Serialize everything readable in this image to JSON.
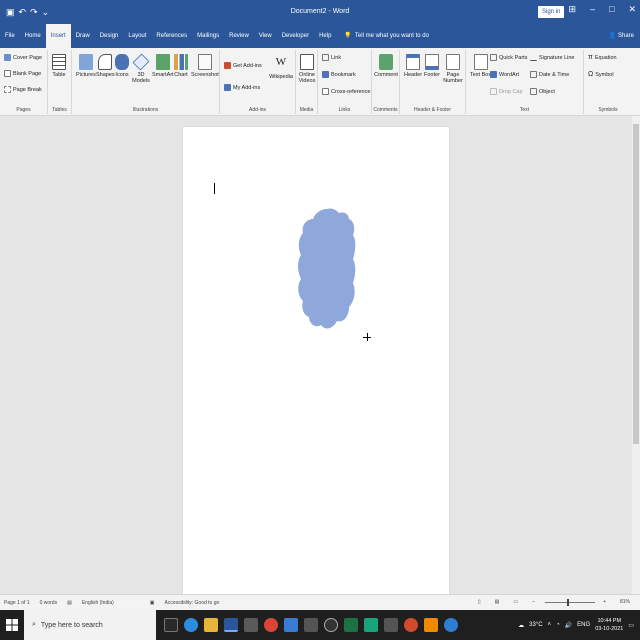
{
  "title_bar": {
    "document_title": "Document2 - Word",
    "signin_label": "Sign in",
    "qat_icons": [
      "save-icon",
      "undo-icon",
      "redo-icon"
    ]
  },
  "ribbon_tabs": [
    "File",
    "Home",
    "Insert",
    "Draw",
    "Design",
    "Layout",
    "References",
    "Mailings",
    "Review",
    "View",
    "Developer",
    "Help"
  ],
  "active_tab": "Insert",
  "tell_me": "Tell me what you want to do",
  "share_label": "Share",
  "groups": {
    "pages": {
      "label": "Pages",
      "items": [
        "Cover Page",
        "Blank Page",
        "Page Break"
      ]
    },
    "tables": {
      "label": "Tables",
      "table": "Table"
    },
    "illustrations": {
      "label": "Illustrations",
      "pictures": "Pictures",
      "shapes": "Shapes",
      "icons": "Icons",
      "models": "3D Models",
      "smartart": "SmartArt",
      "chart": "Chart",
      "screenshot": "Screenshot"
    },
    "addins": {
      "label": "Add-ins",
      "get": "Get Add-ins",
      "my": "My Add-ins",
      "wikipedia": "Wikipedia"
    },
    "media": {
      "label": "Media",
      "online_videos": "Online Videos"
    },
    "links": {
      "label": "Links",
      "link": "Link",
      "bookmark": "Bookmark",
      "crossref": "Cross-reference"
    },
    "comments": {
      "label": "Comments",
      "comment": "Comment"
    },
    "header_footer": {
      "label": "Header & Footer",
      "header": "Header",
      "footer": "Footer",
      "page_number": "Page Number"
    },
    "text": {
      "label": "Text",
      "text_box": "Text Box",
      "quick_parts": "Quick Parts",
      "wordart": "WordArt",
      "drop_cap": "Drop Cap",
      "signature_line": "Signature Line",
      "date_time": "Date & Time",
      "object": "Object"
    },
    "symbols": {
      "label": "Symbols",
      "equation": "Equation",
      "symbol": "Symbol"
    }
  },
  "status_bar": {
    "page": "Page 1 of 1",
    "words": "0 words",
    "language": "English (India)",
    "accessibility": "Accessibility: Good to go",
    "zoom": "81%"
  },
  "taskbar": {
    "search_placeholder": "Type here to search",
    "temperature": "33°C",
    "language": "ENG",
    "time": "10:44 PM",
    "date": "03-10-2021"
  },
  "colors": {
    "word_blue": "#2b579a",
    "shape_fill": "#8fa8dc"
  }
}
